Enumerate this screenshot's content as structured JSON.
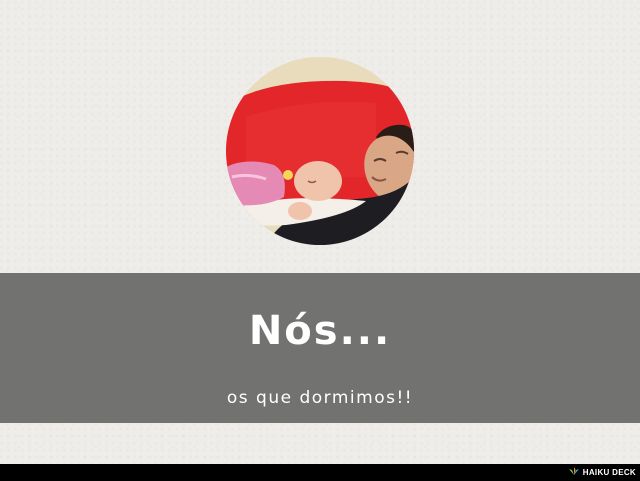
{
  "slide": {
    "title": "Nós...",
    "subtitle": "os que dormimos!!"
  },
  "photo": {
    "icon": "photo-sleeping-father-and-baby"
  },
  "footer": {
    "brand_label": "HAIKU DECK",
    "brand_icon": "haiku-deck-logo-icon"
  },
  "colors": {
    "background": "#efedea",
    "band": "#727271",
    "text": "#ffffff",
    "footer": "#000000"
  }
}
